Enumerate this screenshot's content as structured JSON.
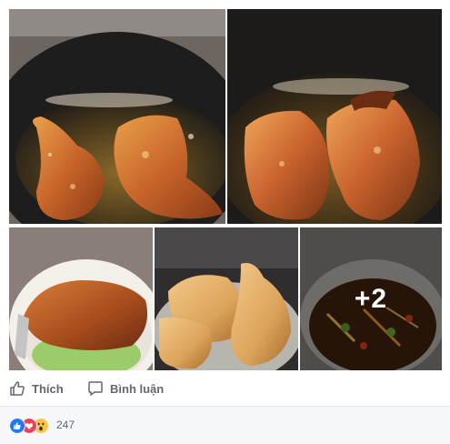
{
  "post": {
    "photos": [
      {
        "name": "photo-chicken-frying-1",
        "desc": "two chicken legs frying in oil"
      },
      {
        "name": "photo-chicken-frying-2",
        "desc": "chicken halves frying in oil"
      },
      {
        "name": "photo-chicken-plate",
        "desc": "fried chicken on plate with green rice"
      },
      {
        "name": "photo-chicken-tray",
        "desc": "roast chicken pieces on tray"
      },
      {
        "name": "photo-pot-broth",
        "desc": "pot of broth with herbs"
      }
    ],
    "more_photos_label": "+2"
  },
  "actions": {
    "like_label": "Thích",
    "comment_label": "Bình luận"
  },
  "reactions": {
    "icons": [
      "like-icon",
      "love-icon",
      "wow-icon"
    ],
    "count": "247",
    "colors": {
      "like": "#2078f4",
      "love": "#f33e58",
      "wow": "#fcc33f"
    }
  }
}
